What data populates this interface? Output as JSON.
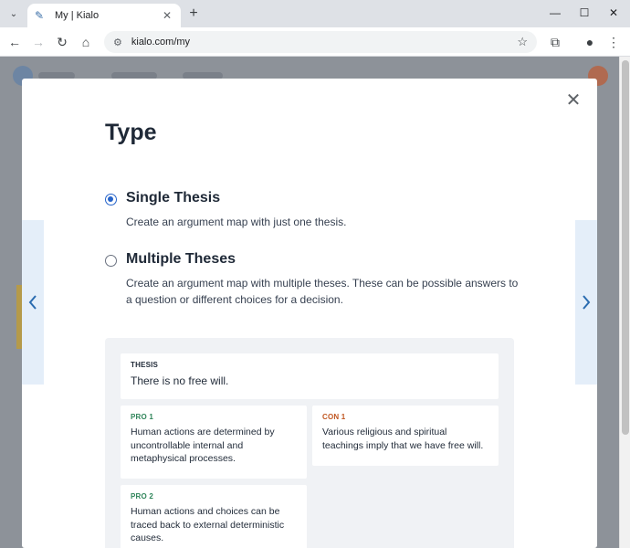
{
  "browser": {
    "tab_title": "My | Kialo",
    "url": "kialo.com/my",
    "new_tab_label": "+",
    "close_tab_label": "✕"
  },
  "modal": {
    "title": "Type",
    "options": [
      {
        "title": "Single Thesis",
        "description": "Create an argument map with just one thesis.",
        "selected": true
      },
      {
        "title": "Multiple Theses",
        "description": "Create an argument map with multiple theses. These can be possible answers to a question or different choices for a decision.",
        "selected": false
      }
    ],
    "example": {
      "thesis": {
        "label": "THESIS",
        "text": "There is no free will."
      },
      "pro1": {
        "label": "PRO 1",
        "text": "Human actions are determined by uncontrollable internal and metaphysical processes."
      },
      "con1": {
        "label": "CON 1",
        "text": "Various religious and spiritual teachings imply that we have free will."
      },
      "pro2": {
        "label": "PRO 2",
        "text": "Human actions and choices can be traced back to external deterministic causes."
      }
    }
  },
  "colors": {
    "accent": "#2563c9",
    "pro": "#2f855a",
    "con": "#c05621",
    "side_nav_bg": "#e4eef9"
  }
}
